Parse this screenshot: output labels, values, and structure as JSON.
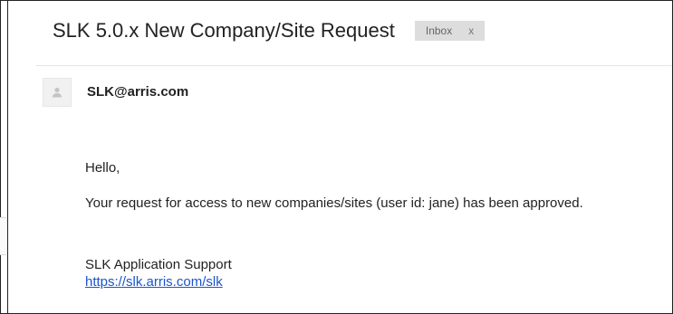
{
  "email": {
    "subject": "SLK 5.0.x New Company/Site Request",
    "label": {
      "name": "Inbox",
      "remove": "x"
    },
    "sender": "SLK@arris.com",
    "body": {
      "greeting": "Hello,",
      "paragraph": "Your request for access to new companies/sites (user id: jane) has been approved.",
      "signature": "SLK Application Support",
      "link": "https://slk.arris.com/slk"
    }
  },
  "icons": {
    "avatar": "person-icon"
  },
  "colors": {
    "link": "#1a55cc",
    "label_bg": "#dddddd",
    "divider": "#e5e5e5"
  }
}
